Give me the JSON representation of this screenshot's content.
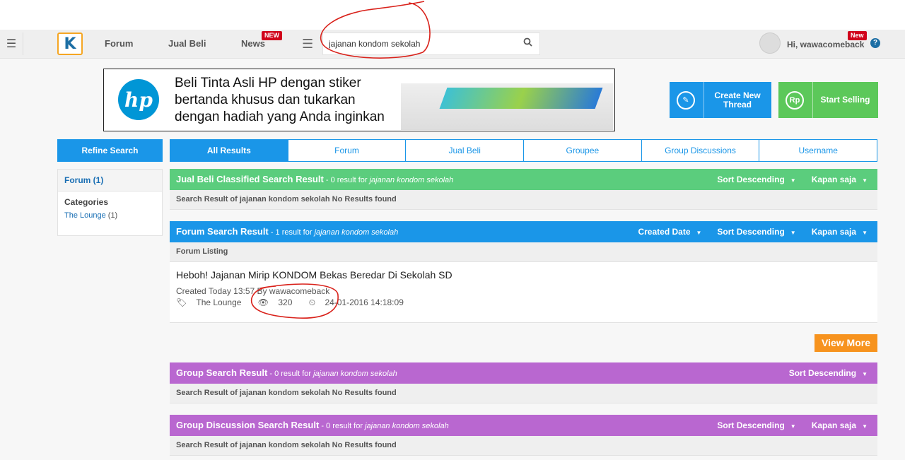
{
  "nav": {
    "menu_icon": "hamburger-icon",
    "links": [
      {
        "label": "Forum"
      },
      {
        "label": "Jual Beli"
      },
      {
        "label": "News",
        "badge": "NEW"
      }
    ],
    "search": {
      "value": "jajanan kondom sekolah",
      "placeholder": ""
    },
    "user_greeting": "Hi, wawacomeback",
    "user_badge": "New",
    "help_label": "?"
  },
  "ad": {
    "logo_text": "hp",
    "lines": [
      "Beli Tinta Asli HP dengan stiker",
      "bertanda khusus dan tukarkan",
      "dengan hadiah yang Anda inginkan"
    ]
  },
  "actions": {
    "create_label": "Create New Thread",
    "sell_label": "Start Selling",
    "sell_icon_text": "Rp"
  },
  "sidebar": {
    "refine_label": "Refine Search",
    "forum_label": "Forum (1)",
    "categories_label": "Categories",
    "lounge_label": "The Lounge",
    "lounge_count": "(1)"
  },
  "tabs": [
    "All Results",
    "Forum",
    "Jual Beli",
    "Groupee",
    "Group Discussions",
    "Username"
  ],
  "sections": {
    "jualbeli": {
      "title": "Jual Beli Classified Search Result",
      "count_text": " - 0 result for ",
      "query": "jajanan kondom sekolah",
      "sorts": [
        "Sort Descending",
        "Kapan saja"
      ],
      "row": "Search Result of jajanan kondom sekolah No Results found",
      "color": "#5bcd7d"
    },
    "forum": {
      "title": "Forum Search Result",
      "count_text": " - 1 result for ",
      "query": "jajanan kondom sekolah",
      "sorts": [
        "Created Date",
        "Sort Descending",
        "Kapan saja"
      ],
      "row": "Forum Listing",
      "color": "#1a96e8"
    },
    "group": {
      "title": "Group Search Result",
      "count_text": " - 0 result for ",
      "query": "jajanan kondom sekolah",
      "sorts": [
        "Sort Descending"
      ],
      "row": "Search Result of jajanan kondom sekolah No Results found",
      "color": "#b967d0"
    },
    "groupdisc": {
      "title": "Group Discussion Search Result",
      "count_text": " - 0 result for ",
      "query": "jajanan kondom sekolah",
      "sorts": [
        "Sort Descending",
        "Kapan saja"
      ],
      "row": "Search Result of jajanan kondom sekolah No Results found",
      "color": "#b967d0"
    }
  },
  "result": {
    "title": "Heboh! Jajanan Mirip KONDOM Bekas Beredar Di Sekolah SD",
    "created": "Created Today 13:57",
    "by": "By wawacomeback",
    "category": "The Lounge",
    "views": "320",
    "last_post": "24-01-2016 14:18:09"
  },
  "view_more_label": "View More"
}
